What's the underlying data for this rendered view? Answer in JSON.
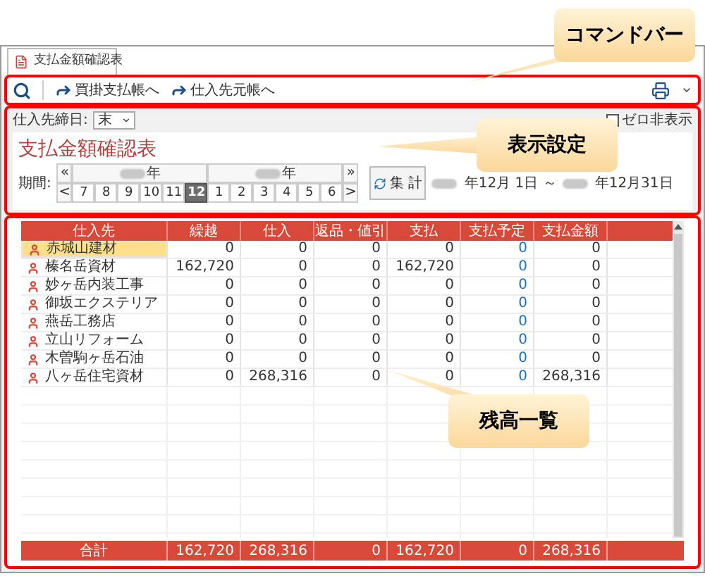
{
  "tab": {
    "label": "支払金額確認表",
    "selected": true
  },
  "toolbar": {
    "links": [
      {
        "label": "買掛支払帳へ"
      },
      {
        "label": "仕入先元帳へ"
      }
    ]
  },
  "settings": {
    "closing_day_label": "仕入先締日:",
    "closing_day_value": "末",
    "zero_hide": {
      "label": "ゼロ非表示",
      "checked": false
    },
    "title": "支払金額確認表",
    "period_label": "期間:",
    "prev_year": "«",
    "next_year": "»",
    "prev_month": "<",
    "next_month": ">",
    "years": [
      "年",
      "年"
    ],
    "months": [
      {
        "label": "7",
        "selected": false
      },
      {
        "label": "8",
        "selected": false
      },
      {
        "label": "9",
        "selected": false
      },
      {
        "label": "10",
        "selected": false
      },
      {
        "label": "11",
        "selected": false
      },
      {
        "label": "12",
        "selected": true
      },
      {
        "label": "1",
        "selected": false
      },
      {
        "label": "2",
        "selected": false
      },
      {
        "label": "3",
        "selected": false
      },
      {
        "label": "4",
        "selected": false
      },
      {
        "label": "5",
        "selected": false
      },
      {
        "label": "6",
        "selected": false
      }
    ],
    "aggregate_button": "集 計",
    "range_start": "年12月 1日 ～",
    "range_end": "年12月31日"
  },
  "table": {
    "columns": [
      "仕入先",
      "繰越",
      "仕入",
      "返品・値引",
      "支払",
      "支払予定",
      "支払金額"
    ],
    "rows": [
      {
        "selected": true,
        "cells": [
          "赤城山建材",
          "0",
          "0",
          "0",
          "0",
          "0",
          "0"
        ]
      },
      {
        "selected": false,
        "cells": [
          "榛名岳資材",
          "162,720",
          "0",
          "0",
          "162,720",
          "0",
          "0"
        ]
      },
      {
        "selected": false,
        "cells": [
          "妙ヶ岳内装工事",
          "0",
          "0",
          "0",
          "0",
          "0",
          "0"
        ]
      },
      {
        "selected": false,
        "cells": [
          "御坂エクステリア",
          "0",
          "0",
          "0",
          "0",
          "0",
          "0"
        ]
      },
      {
        "selected": false,
        "cells": [
          "燕岳工務店",
          "0",
          "0",
          "0",
          "0",
          "0",
          "0"
        ]
      },
      {
        "selected": false,
        "cells": [
          "立山リフォーム",
          "0",
          "0",
          "0",
          "0",
          "0",
          "0"
        ]
      },
      {
        "selected": false,
        "cells": [
          "木曽駒ヶ岳石油",
          "0",
          "0",
          "0",
          "0",
          "0",
          "0"
        ]
      },
      {
        "selected": false,
        "cells": [
          "八ヶ岳住宅資材",
          "0",
          "268,316",
          "0",
          "0",
          "0",
          "268,316"
        ]
      }
    ],
    "footer": [
      "合計",
      "162,720",
      "268,316",
      "0",
      "162,720",
      "0",
      "268,316"
    ]
  },
  "callouts": [
    "コマンドバー",
    "表示設定",
    "残高一覧"
  ]
}
